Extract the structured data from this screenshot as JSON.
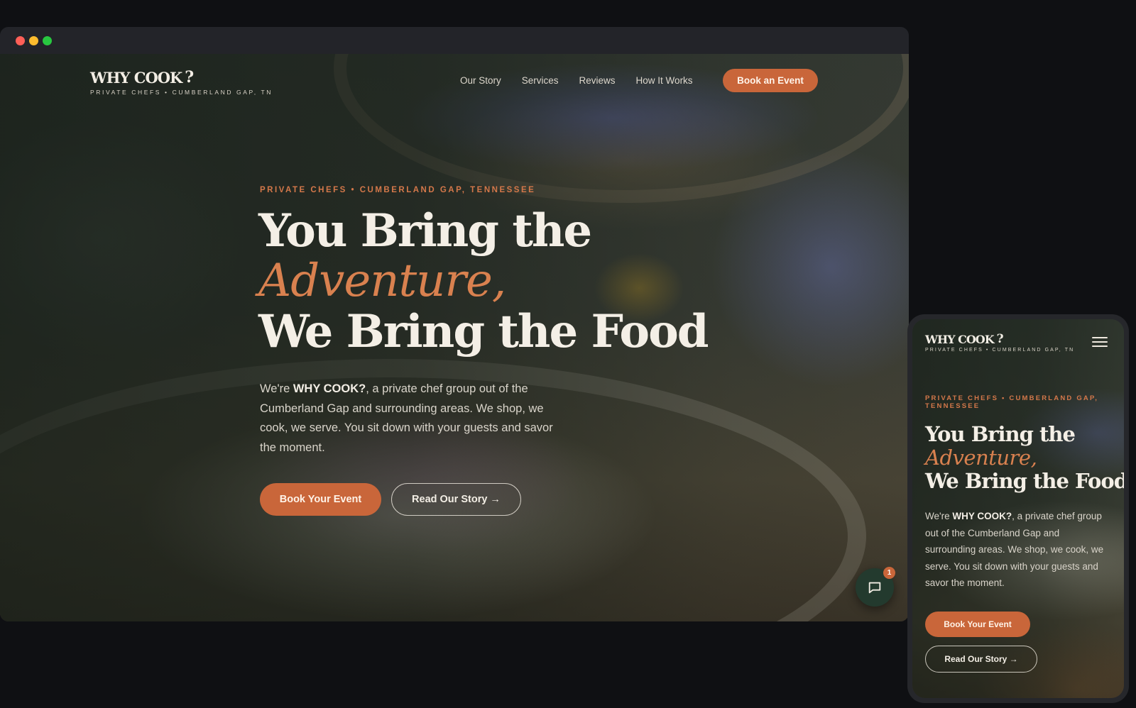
{
  "colors": {
    "accent": "#c9663a",
    "accent_text": "#d9814f",
    "chat_bg": "#233a2e",
    "background": "#0f1013"
  },
  "brand": {
    "name": "WHY COOK",
    "mark": "?",
    "tagline": "PRIVATE CHEFS • CUMBERLAND GAP, TN"
  },
  "nav": {
    "items": [
      {
        "label": "Our Story"
      },
      {
        "label": "Services"
      },
      {
        "label": "Reviews"
      },
      {
        "label": "How It Works"
      }
    ],
    "cta_label": "Book an Event"
  },
  "hero": {
    "eyebrow": "PRIVATE CHEFS • CUMBERLAND GAP, TENNESSEE",
    "headline_1": "You Bring the",
    "headline_accent": "Adventure,",
    "headline_2": "We Bring the Food",
    "lead_pre": "We're ",
    "lead_brand": "WHY COOK?",
    "lead_post": ", a private chef group out of the Cumberland Gap and surrounding areas. We shop, we cook, we serve. You sit down with your guests and savor the moment.",
    "primary_label": "Book Your Event",
    "secondary_label": "Read Our Story →"
  },
  "chat": {
    "icon": "chat-bubble-icon",
    "badge_count": "1"
  },
  "mobile": {
    "menu_icon": "hamburger-menu-icon"
  }
}
